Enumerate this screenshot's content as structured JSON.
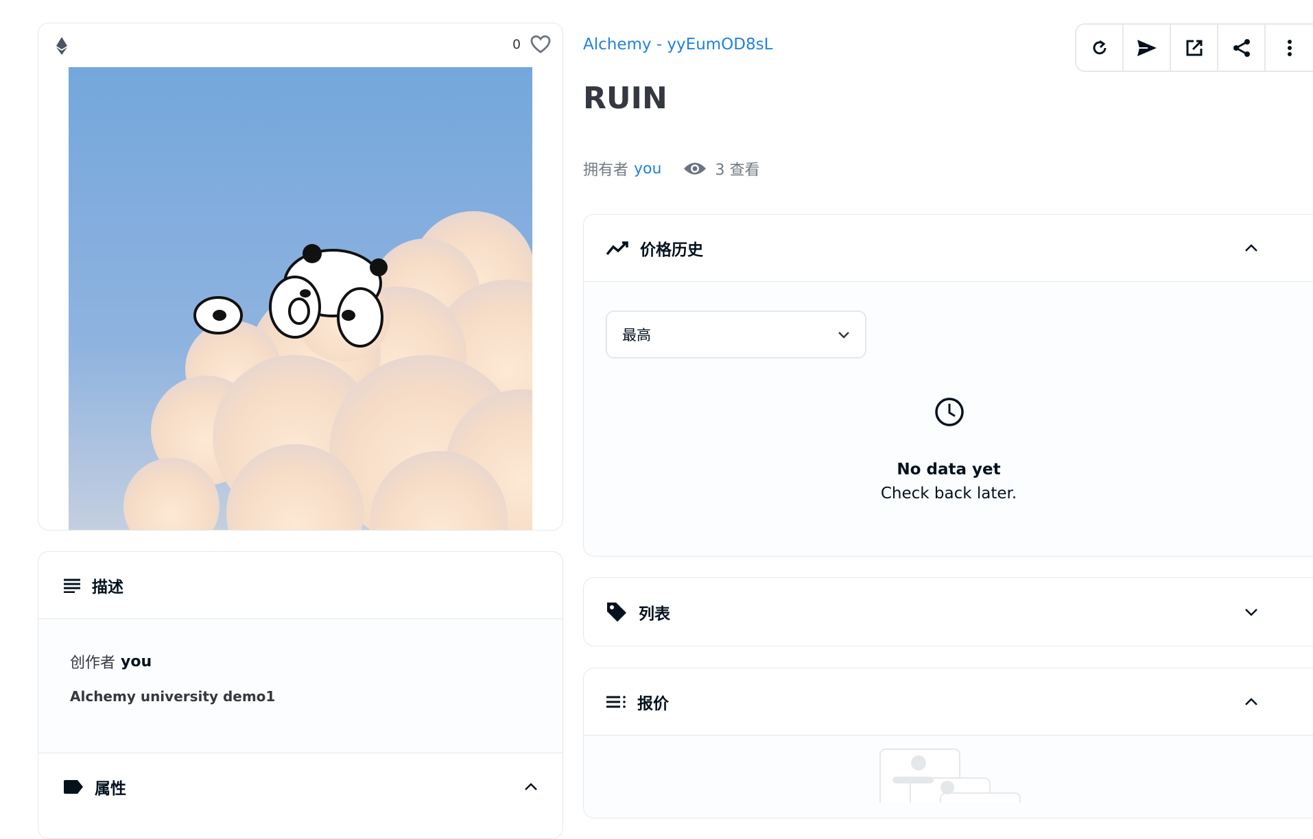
{
  "media_card": {
    "like_count": "0",
    "chain_icon": "ethereum-icon",
    "heart_icon": "heart-outline-icon",
    "image_colors": {
      "sky_top": "#6fa1d8",
      "sky_bottom": "#a8c4e4",
      "cloud": "#fbe3cc"
    }
  },
  "header": {
    "collection": "Alchemy - yyEumOD8sL",
    "title": "RUIN",
    "owner_prefix": "拥有者",
    "owner_name": "you",
    "views": "3 查看"
  },
  "toolbar": {
    "buttons": [
      "refresh-icon",
      "send-icon",
      "external-link-icon",
      "share-icon",
      "more-vertical-icon"
    ]
  },
  "price_history": {
    "title": "价格历史",
    "select_value": "最高",
    "empty_title": "No data yet",
    "empty_subtitle": "Check back later."
  },
  "listings": {
    "title": "列表"
  },
  "offers": {
    "title": "报价"
  },
  "description": {
    "title": "描述",
    "creator_prefix": "创作者",
    "creator_name": "you",
    "text": "Alchemy university demo1"
  },
  "properties": {
    "title": "属性"
  },
  "colors": {
    "accent": "#2081e2",
    "text": "#04111d",
    "muted": "#707a83",
    "border": "#e5e8eb"
  }
}
